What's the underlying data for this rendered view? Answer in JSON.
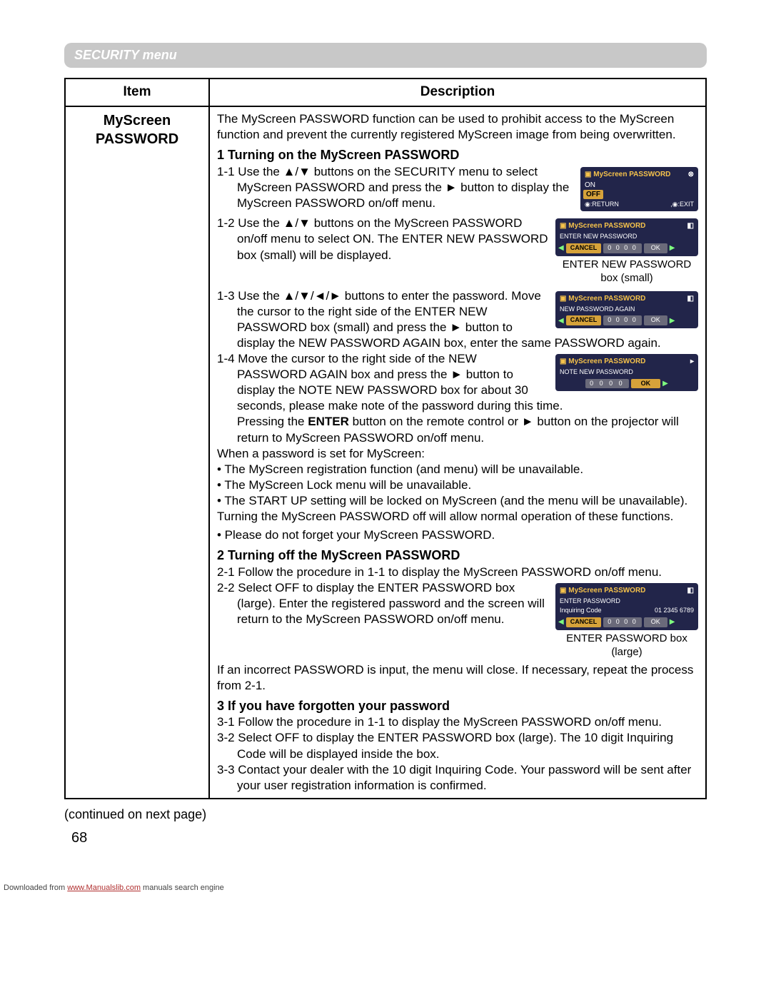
{
  "banner": "SECURITY menu",
  "hdr_item": "Item",
  "hdr_desc": "Description",
  "item_name_l1": "MyScreen",
  "item_name_l2": "PASSWORD",
  "intro": "The MyScreen PASSWORD function can be used to prohibit access to the MyScreen function and prevent the currently registered MyScreen image from being overwritten.",
  "sec1_h": "1 Turning on the MyScreen PASSWORD",
  "sec1_1": "1-1 Use the ▲/▼ buttons on the SECURITY menu to select MyScreen PASSWORD and press the ► button to display the MyScreen PASSWORD on/off menu.",
  "sec1_2": "1-2 Use the ▲/▼ buttons on the MyScreen PASSWORD on/off menu to select ON. The ENTER NEW PASSWORD box (small) will be displayed.",
  "sec1_3": "1-3 Use the ▲/▼/◄/► buttons to enter the password. Move the cursor to the right side of the ENTER NEW PASSWORD box (small) and press the ► button to display the NEW PASSWORD AGAIN box, enter the same PASSWORD again.",
  "sec1_4a": "1-4 Move the cursor to the right side of the NEW PASSWORD AGAIN box and press the ► button to display the NOTE NEW PASSWORD box for about 30 seconds, please make note of the password during this time.",
  "sec1_4b_pre": "Pressing the ",
  "sec1_4b_bold": "ENTER",
  "sec1_4b_post": " button on the remote control or ► button on the projector will return to MyScreen PASSWORD on/off menu.",
  "when_set": "When a password is set for MyScreen:",
  "when_b1": "• The MyScreen registration function (and menu) will be unavailable.",
  "when_b2": "• The MyScreen Lock menu will be unavailable.",
  "when_b3": "• The START UP setting will be locked on MyScreen (and the menu will be unavailable).",
  "when_off": "Turning the MyScreen PASSWORD off will allow normal operation of these functions.",
  "when_forget": "• Please do not forget your MyScreen PASSWORD.",
  "sec2_h": "2 Turning off the MyScreen PASSWORD",
  "sec2_1": "2-1 Follow the procedure in 1-1 to display the MyScreen PASSWORD on/off menu.",
  "sec2_2": "2-2 Select OFF to display the ENTER PASSWORD box (large). Enter the registered password and the screen will return to the MyScreen PASSWORD on/off menu.",
  "sec2_wrong": "If an incorrect PASSWORD is input, the menu will close. If necessary, repeat the process from 2-1.",
  "sec3_h": "3 If you have forgotten your password",
  "sec3_1": "3-1 Follow the procedure in 1-1 to display the MyScreen PASSWORD on/off menu.",
  "sec3_2": "3-2 Select OFF to display the ENTER PASSWORD box (large). The 10 digit Inquiring Code will be displayed inside the box.",
  "sec3_3": "3-3 Contact your dealer with the 10 digit Inquiring Code. Your password will be sent after your user registration information is confirmed.",
  "osd": {
    "title": "MyScreen PASSWORD",
    "on": "ON",
    "off": "OFF",
    "return": "◉:RETURN",
    "exit": ",◉:EXIT",
    "enter_new": "ENTER NEW PASSWORD",
    "again": "NEW PASSWORD AGAIN",
    "note_new": "NOTE NEW PASSWORD",
    "enter_pw": "ENTER PASSWORD",
    "inq": "Inquiring Code",
    "inq_code": "01 2345 6789",
    "cancel": "CANCEL",
    "zeros": "0 0 0 0",
    "ok": "OK"
  },
  "cap_small": "ENTER NEW PASSWORD box (small)",
  "cap_large": "ENTER PASSWORD box (large)",
  "continued": "(continued on next page)",
  "pagenum": "68",
  "footer_pre": "Downloaded from ",
  "footer_link": "www.Manualslib.com",
  "footer_post": " manuals search engine"
}
